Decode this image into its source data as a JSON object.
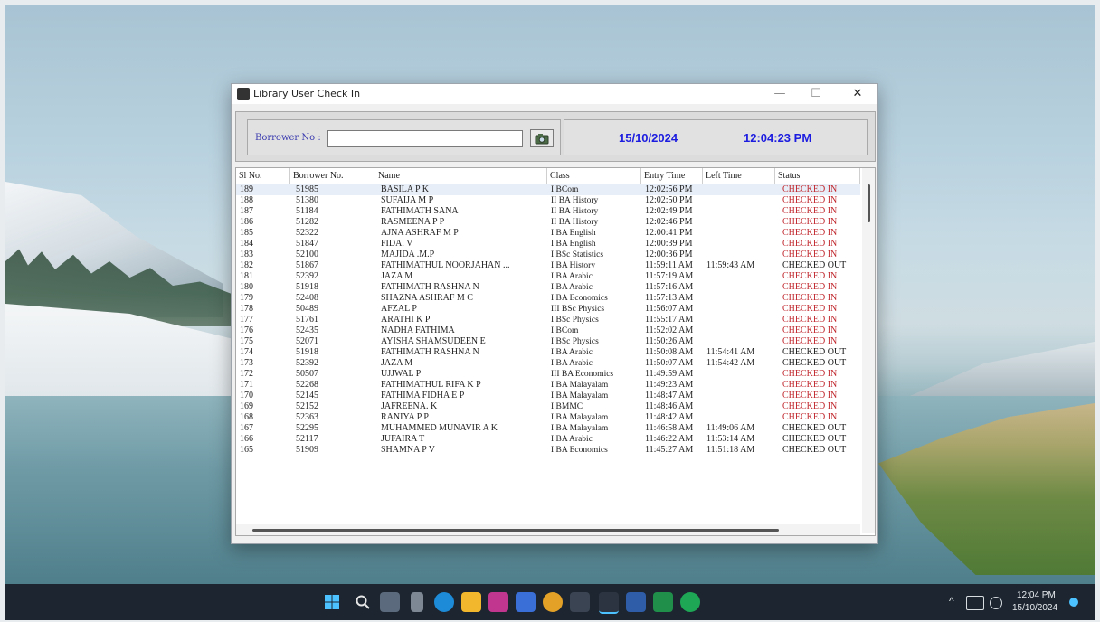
{
  "window": {
    "title": "Library User Check In",
    "minimize": "—",
    "maximize": "☐",
    "close": "✕"
  },
  "borrower": {
    "label": "Borrower No :",
    "value": ""
  },
  "datetime": {
    "date": "15/10/2024",
    "time": "12:04:23 PM"
  },
  "table": {
    "headers": [
      "Sl No.",
      "Borrower No.",
      "Name",
      "Class",
      "Entry Time",
      "Left Time",
      "Status"
    ],
    "rows": [
      {
        "sl": "189",
        "borrower": "51985",
        "name": "BASILA P K",
        "class": "I BCom",
        "entry": "12:02:56 PM",
        "left": "",
        "status": "CHECKED IN"
      },
      {
        "sl": "188",
        "borrower": "51380",
        "name": "SUFAIJA M P",
        "class": "II BA History",
        "entry": "12:02:50 PM",
        "left": "",
        "status": "CHECKED IN"
      },
      {
        "sl": "187",
        "borrower": "51184",
        "name": "FATHIMATH SANA",
        "class": "II BA History",
        "entry": "12:02:49 PM",
        "left": "",
        "status": "CHECKED IN"
      },
      {
        "sl": "186",
        "borrower": "51282",
        "name": "RASMEENA P P",
        "class": "II BA History",
        "entry": "12:02:46 PM",
        "left": "",
        "status": "CHECKED IN"
      },
      {
        "sl": "185",
        "borrower": "52322",
        "name": "AJNA ASHRAF M P",
        "class": "I BA English",
        "entry": "12:00:41 PM",
        "left": "",
        "status": "CHECKED IN"
      },
      {
        "sl": "184",
        "borrower": "51847",
        "name": "FIDA. V",
        "class": "I BA English",
        "entry": "12:00:39 PM",
        "left": "",
        "status": "CHECKED IN"
      },
      {
        "sl": "183",
        "borrower": "52100",
        "name": "MAJIDA .M.P",
        "class": "I BSc Statistics",
        "entry": "12:00:36 PM",
        "left": "",
        "status": "CHECKED IN"
      },
      {
        "sl": "182",
        "borrower": "51867",
        "name": "FATHIMATHUL NOORJAHAN ...",
        "class": "I BA History",
        "entry": "11:59:11 AM",
        "left": "11:59:43 AM",
        "status": "CHECKED OUT"
      },
      {
        "sl": "181",
        "borrower": "52392",
        "name": "JAZA M",
        "class": "I BA Arabic",
        "entry": "11:57:19 AM",
        "left": "",
        "status": "CHECKED IN"
      },
      {
        "sl": "180",
        "borrower": "51918",
        "name": "FATHIMATH RASHNA N",
        "class": "I BA Arabic",
        "entry": "11:57:16 AM",
        "left": "",
        "status": "CHECKED IN"
      },
      {
        "sl": "179",
        "borrower": "52408",
        "name": "SHAZNA ASHRAF M C",
        "class": "I BA Economics",
        "entry": "11:57:13 AM",
        "left": "",
        "status": "CHECKED IN"
      },
      {
        "sl": "178",
        "borrower": "50489",
        "name": "AFZAL P",
        "class": "III BSc Physics",
        "entry": "11:56:07 AM",
        "left": "",
        "status": "CHECKED IN"
      },
      {
        "sl": "177",
        "borrower": "51761",
        "name": "ARATHI K P",
        "class": "I BSc Physics",
        "entry": "11:55:17 AM",
        "left": "",
        "status": "CHECKED IN"
      },
      {
        "sl": "176",
        "borrower": "52435",
        "name": "NADHA FATHIMA",
        "class": "I BCom",
        "entry": "11:52:02 AM",
        "left": "",
        "status": "CHECKED IN"
      },
      {
        "sl": "175",
        "borrower": "52071",
        "name": "AYISHA SHAMSUDEEN E",
        "class": "I BSc Physics",
        "entry": "11:50:26 AM",
        "left": "",
        "status": "CHECKED IN"
      },
      {
        "sl": "174",
        "borrower": "51918",
        "name": "FATHIMATH RASHNA N",
        "class": "I BA Arabic",
        "entry": "11:50:08 AM",
        "left": "11:54:41 AM",
        "status": "CHECKED OUT"
      },
      {
        "sl": "173",
        "borrower": "52392",
        "name": "JAZA M",
        "class": "I BA Arabic",
        "entry": "11:50:07 AM",
        "left": "11:54:42 AM",
        "status": "CHECKED OUT"
      },
      {
        "sl": "172",
        "borrower": "50507",
        "name": "UJJWAL P",
        "class": "III BA Economics",
        "entry": "11:49:59 AM",
        "left": "",
        "status": "CHECKED IN"
      },
      {
        "sl": "171",
        "borrower": "52268",
        "name": "FATHIMATHUL RIFA K P",
        "class": "I BA Malayalam",
        "entry": "11:49:23 AM",
        "left": "",
        "status": "CHECKED IN"
      },
      {
        "sl": "170",
        "borrower": "52145",
        "name": "FATHIMA FIDHA E P",
        "class": "I BA Malayalam",
        "entry": "11:48:47 AM",
        "left": "",
        "status": "CHECKED IN"
      },
      {
        "sl": "169",
        "borrower": "52152",
        "name": "JAFREENA. K",
        "class": "I BMMC",
        "entry": "11:48:46 AM",
        "left": "",
        "status": "CHECKED IN"
      },
      {
        "sl": "168",
        "borrower": "52363",
        "name": "RANIYA P P",
        "class": "I BA Malayalam",
        "entry": "11:48:42 AM",
        "left": "",
        "status": "CHECKED IN"
      },
      {
        "sl": "167",
        "borrower": "52295",
        "name": "MUHAMMED MUNAVIR A K",
        "class": "I BA Malayalam",
        "entry": "11:46:58 AM",
        "left": "11:49:06 AM",
        "status": "CHECKED OUT"
      },
      {
        "sl": "166",
        "borrower": "52117",
        "name": "JUFAIRA T",
        "class": "I BA Arabic",
        "entry": "11:46:22 AM",
        "left": "11:53:14 AM",
        "status": "CHECKED OUT"
      },
      {
        "sl": "165",
        "borrower": "51909",
        "name": "SHAMNA P V",
        "class": "I BA Economics",
        "entry": "11:45:27 AM",
        "left": "11:51:18 AM",
        "status": "CHECKED OUT"
      }
    ]
  },
  "taskbar": {
    "time": "12:04 PM",
    "date": "15/10/2024",
    "tray_up": "^"
  },
  "colors": {
    "accent_blue": "#1c1ce0",
    "checked_in": "#c0272d",
    "checked_out": "#1a1a1a"
  }
}
